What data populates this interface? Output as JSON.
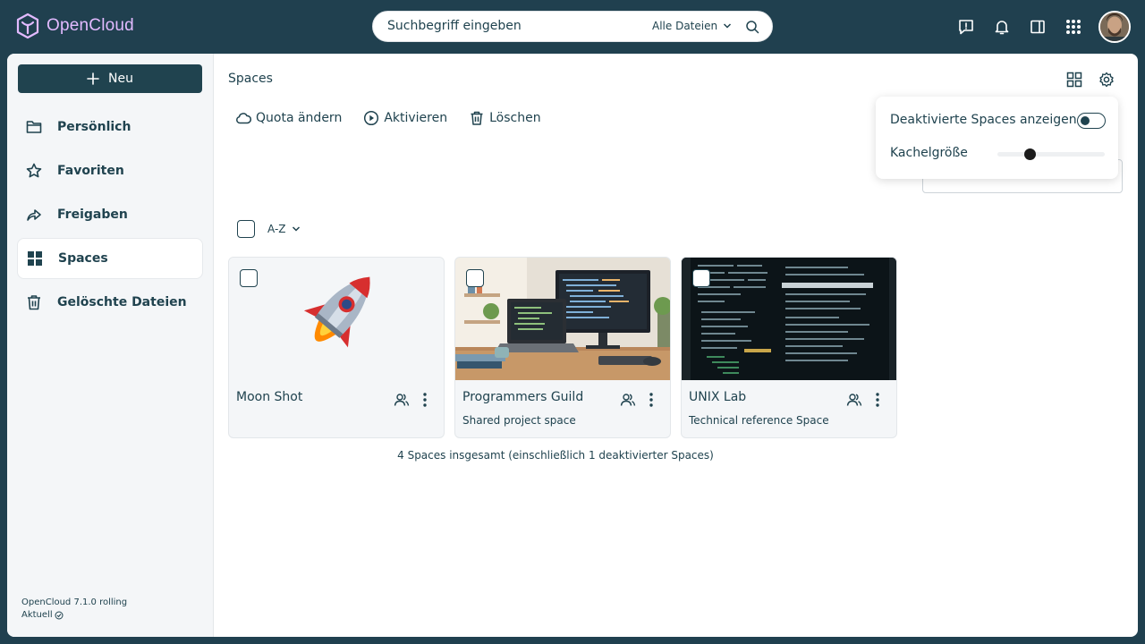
{
  "app": {
    "name": "OpenCloud",
    "brand_color": "#e2baff",
    "bg_color": "#20404f"
  },
  "search": {
    "placeholder": "Suchbegriff eingeben",
    "scope": "Alle Dateien"
  },
  "topbar_icons": [
    "feedback-icon",
    "bell-icon",
    "sidebar-panel-icon",
    "app-grid-icon"
  ],
  "sidebar": {
    "new_label": "Neu",
    "items": [
      {
        "label": "Persönlich",
        "icon": "folder-icon"
      },
      {
        "label": "Favoriten",
        "icon": "star-icon"
      },
      {
        "label": "Freigaben",
        "icon": "share-arrow-icon"
      },
      {
        "label": "Spaces",
        "icon": "spaces-grid-icon",
        "active": true
      },
      {
        "label": "Gelöschte Dateien",
        "icon": "trash-icon"
      }
    ],
    "version": "OpenCloud 7.1.0 rolling",
    "status": "Aktuell"
  },
  "breadcrumb": "Spaces",
  "actions": [
    {
      "label": "Quota ändern",
      "icon": "cloud-icon"
    },
    {
      "label": "Aktivieren",
      "icon": "play-circle-icon"
    },
    {
      "label": "Löschen",
      "icon": "trash-icon"
    }
  ],
  "settings_popover": {
    "show_disabled_label": "Deaktivierte Spaces anzeigen",
    "show_disabled_on": false,
    "tile_size_label": "Kachelgröße",
    "tile_size_value": 0.3
  },
  "sort": {
    "label": "A-Z"
  },
  "spaces": [
    {
      "name": "Moon Shot",
      "description": "",
      "thumbnail": "rocket"
    },
    {
      "name": "Programmers Guild",
      "description": "Shared project space",
      "thumbnail": "desk"
    },
    {
      "name": "UNIX Lab",
      "description": "Technical reference Space",
      "thumbnail": "terminal"
    }
  ],
  "total_text": "4 Spaces insgesamt (einschließlich 1 deaktivierter Spaces)"
}
